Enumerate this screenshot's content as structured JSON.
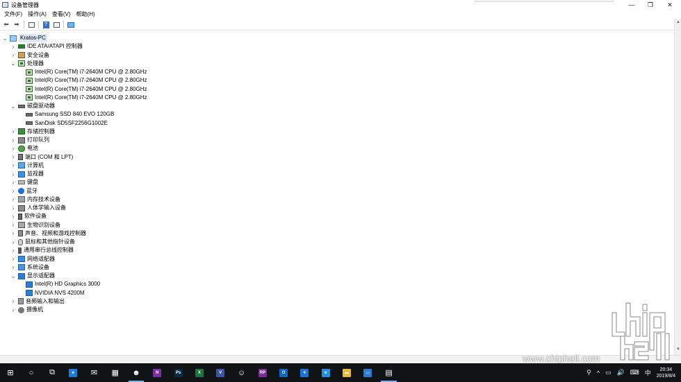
{
  "window": {
    "title": "设备管理器",
    "controls": {
      "minimize": "—",
      "maximize": "❐",
      "close": "✕"
    }
  },
  "menu": [
    "文件(F)",
    "操作(A)",
    "查看(V)",
    "帮助(H)"
  ],
  "toolbar": {
    "back": "⬅",
    "forward": "➡",
    "help": "?"
  },
  "tree": {
    "root": "Kratos-PC",
    "nodes": [
      {
        "label": "IDE ATA/ATAPI 控制器",
        "icon": "ide-icon",
        "cls": "i-ide",
        "expanded": false,
        "children": []
      },
      {
        "label": "安全设备",
        "icon": "security-device-icon",
        "cls": "i-sec",
        "expanded": false,
        "children": []
      },
      {
        "label": "处理器",
        "icon": "processor-icon",
        "cls": "i-cpu",
        "expanded": true,
        "children": [
          {
            "label": "Intel(R) Core(TM) i7-2640M CPU @ 2.80GHz",
            "icon": "processor-icon",
            "cls": "i-cpu"
          },
          {
            "label": "Intel(R) Core(TM) i7-2640M CPU @ 2.80GHz",
            "icon": "processor-icon",
            "cls": "i-cpu"
          },
          {
            "label": "Intel(R) Core(TM) i7-2640M CPU @ 2.80GHz",
            "icon": "processor-icon",
            "cls": "i-cpu"
          },
          {
            "label": "Intel(R) Core(TM) i7-2640M CPU @ 2.80GHz",
            "icon": "processor-icon",
            "cls": "i-cpu"
          }
        ]
      },
      {
        "label": "磁盘驱动器",
        "icon": "disk-drive-icon",
        "cls": "i-disk",
        "expanded": true,
        "children": [
          {
            "label": "Samsung SSD 840 EVO 120GB",
            "icon": "disk-drive-icon",
            "cls": "i-disk"
          },
          {
            "label": "SanDisk SD5SF2256G1002E",
            "icon": "disk-drive-icon",
            "cls": "i-disk"
          }
        ]
      },
      {
        "label": "存储控制器",
        "icon": "storage-controller-icon",
        "cls": "i-store",
        "expanded": false,
        "children": []
      },
      {
        "label": "打印队列",
        "icon": "print-queue-icon",
        "cls": "i-print",
        "expanded": false,
        "children": []
      },
      {
        "label": "电池",
        "icon": "battery-icon",
        "cls": "i-bat",
        "expanded": false,
        "children": []
      },
      {
        "label": "端口 (COM 和 LPT)",
        "icon": "port-icon",
        "cls": "i-port",
        "expanded": false,
        "children": []
      },
      {
        "label": "计算机",
        "icon": "computer-icon",
        "cls": "i-comp",
        "expanded": false,
        "children": []
      },
      {
        "label": "监视器",
        "icon": "monitor-icon",
        "cls": "i-mon",
        "expanded": false,
        "children": []
      },
      {
        "label": "键盘",
        "icon": "keyboard-icon",
        "cls": "i-kbd",
        "expanded": false,
        "children": []
      },
      {
        "label": "蓝牙",
        "icon": "bluetooth-icon",
        "cls": "i-bt",
        "expanded": false,
        "children": []
      },
      {
        "label": "内存技术设备",
        "icon": "memory-device-icon",
        "cls": "i-mem",
        "expanded": false,
        "children": []
      },
      {
        "label": "人体学输入设备",
        "icon": "hid-icon",
        "cls": "i-hid",
        "expanded": false,
        "children": []
      },
      {
        "label": "软件设备",
        "icon": "software-device-icon",
        "cls": "i-soft",
        "expanded": false,
        "children": []
      },
      {
        "label": "生物识别设备",
        "icon": "biometric-icon",
        "cls": "i-bio",
        "expanded": false,
        "children": []
      },
      {
        "label": "声音、视频和游戏控制器",
        "icon": "sound-icon",
        "cls": "i-snd",
        "expanded": false,
        "children": []
      },
      {
        "label": "鼠标和其他指针设备",
        "icon": "mouse-icon",
        "cls": "i-mouse",
        "expanded": false,
        "children": []
      },
      {
        "label": "通用串行总线控制器",
        "icon": "usb-icon",
        "cls": "i-usb",
        "expanded": false,
        "children": []
      },
      {
        "label": "网络适配器",
        "icon": "network-adapter-icon",
        "cls": "i-net",
        "expanded": false,
        "children": []
      },
      {
        "label": "系统设备",
        "icon": "system-device-icon",
        "cls": "i-sys",
        "expanded": false,
        "children": []
      },
      {
        "label": "显示适配器",
        "icon": "display-adapter-icon",
        "cls": "i-disp",
        "expanded": true,
        "children": [
          {
            "label": "Intel(R) HD Graphics 3000",
            "icon": "display-adapter-icon",
            "cls": "i-disp"
          },
          {
            "label": "NVIDIA NVS 4200M",
            "icon": "display-adapter-icon",
            "cls": "i-disp"
          }
        ]
      },
      {
        "label": "音频输入和输出",
        "icon": "audio-io-icon",
        "cls": "i-audio",
        "expanded": false,
        "children": []
      },
      {
        "label": "摄像机",
        "icon": "camera-icon",
        "cls": "i-cam",
        "expanded": false,
        "children": []
      }
    ]
  },
  "taskbar": {
    "apps": [
      {
        "name": "start-button",
        "glyph": "⊞"
      },
      {
        "name": "search-button",
        "glyph": "○"
      },
      {
        "name": "task-view-button",
        "glyph": "⧉"
      },
      {
        "name": "edge-icon",
        "glyph": "e",
        "bg": "#1f7ad6"
      },
      {
        "name": "mail-icon",
        "glyph": "✉"
      },
      {
        "name": "store-icon",
        "glyph": "▦"
      },
      {
        "name": "app-icon",
        "glyph": "☻",
        "active": true
      },
      {
        "name": "onenote-icon",
        "glyph": "N",
        "bg": "#7b2ea6"
      },
      {
        "name": "photoshop-icon",
        "glyph": "Ps",
        "bg": "#0b2a44"
      },
      {
        "name": "excel-icon",
        "glyph": "X",
        "bg": "#1e7145"
      },
      {
        "name": "visio-icon",
        "glyph": "V",
        "bg": "#3955a3"
      },
      {
        "name": "emoji-app-icon",
        "glyph": "☺"
      },
      {
        "name": "rp-icon",
        "glyph": "RP",
        "bg": "#7d2a9c"
      },
      {
        "name": "outlook-icon",
        "glyph": "O",
        "bg": "#1466c0"
      },
      {
        "name": "network-app-icon",
        "glyph": "✢",
        "bg": "#1c72d6"
      },
      {
        "name": "ie-icon",
        "glyph": "e",
        "bg": "#2b8de0"
      },
      {
        "name": "folder-icon",
        "glyph": "▬",
        "bg": "#e6b93a"
      },
      {
        "name": "remote-desktop-icon",
        "glyph": "▭",
        "bg": "#2b7bd0"
      },
      {
        "name": "device-manager-task-icon",
        "glyph": "▤",
        "active": true
      }
    ],
    "tray": [
      "⚲",
      "^",
      "▭",
      "🔊",
      "⌨",
      "中"
    ],
    "time": "20:34",
    "date": "2019/8/4"
  },
  "watermark": "www.chiphell.com"
}
